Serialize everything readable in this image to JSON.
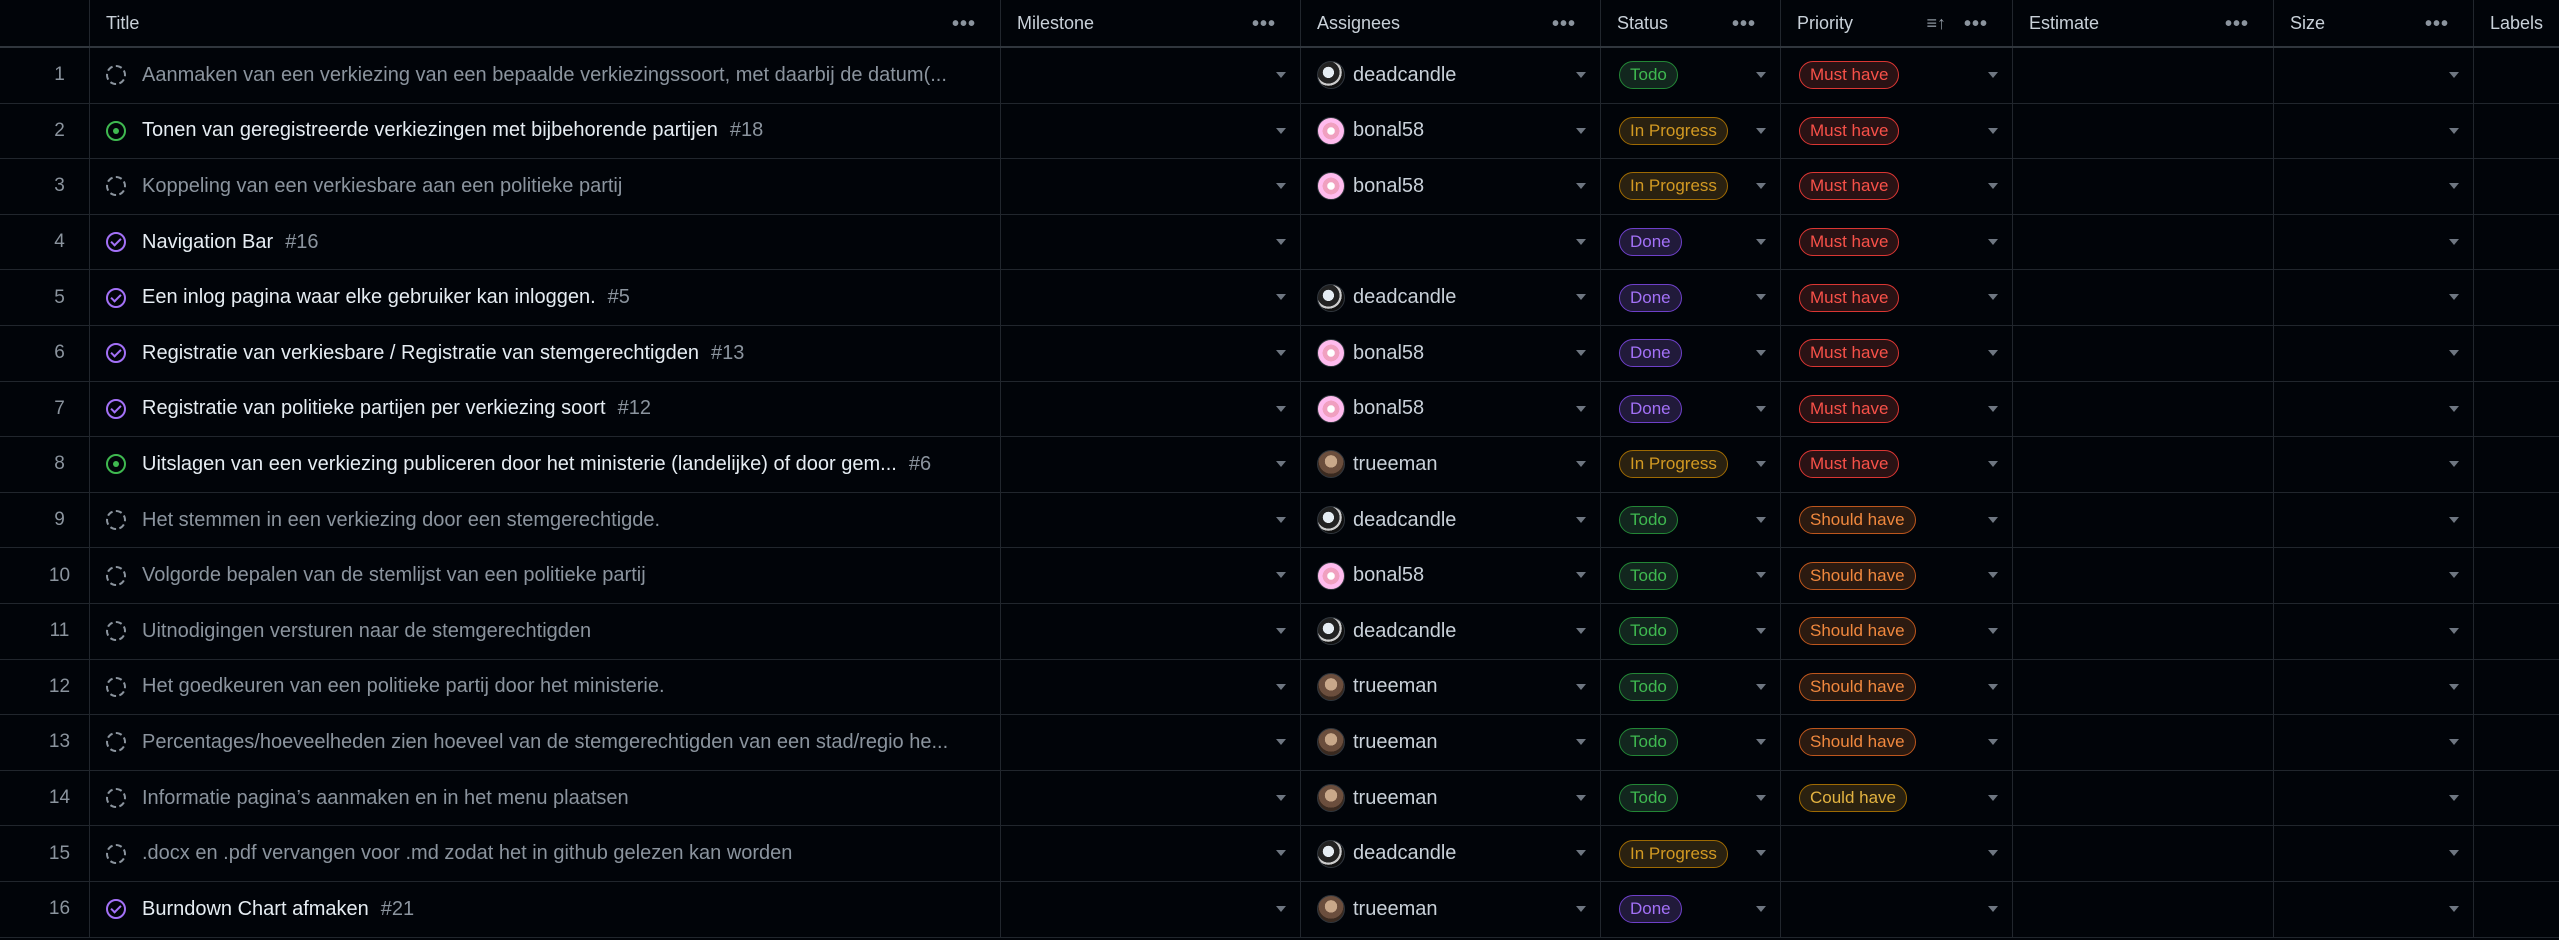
{
  "columns": {
    "title": "Title",
    "milestone": "Milestone",
    "assignees": "Assignees",
    "status": "Status",
    "priority": "Priority",
    "estimate": "Estimate",
    "size": "Size",
    "labels": "Labels",
    "menu_glyph": "•••",
    "sort_glyph": "≡↑"
  },
  "rows": [
    {
      "num": "1",
      "state": "todo",
      "kind": "draft",
      "title": "Aanmaken van een verkiezing van een bepaalde verkiezingssoort, met daarbij de datum(...",
      "issue": "",
      "assignee": "deadcandle",
      "avatar": "deadcandle",
      "status": "Todo",
      "status_kind": "todo",
      "priority": "Must have",
      "priority_kind": "must"
    },
    {
      "num": "2",
      "state": "progress",
      "kind": "issue",
      "title": "Tonen van geregistreerde verkiezingen met bijbehorende partijen",
      "issue": "#18",
      "assignee": "bonal58",
      "avatar": "bonal58",
      "status": "In Progress",
      "status_kind": "progress",
      "priority": "Must have",
      "priority_kind": "must"
    },
    {
      "num": "3",
      "state": "todo",
      "kind": "draft",
      "title": "Koppeling van een verkiesbare aan een politieke partij",
      "issue": "",
      "assignee": "bonal58",
      "avatar": "bonal58",
      "status": "In Progress",
      "status_kind": "progress",
      "priority": "Must have",
      "priority_kind": "must"
    },
    {
      "num": "4",
      "state": "done",
      "kind": "issue",
      "title": "Navigation Bar",
      "issue": "#16",
      "assignee": "",
      "avatar": "",
      "status": "Done",
      "status_kind": "done",
      "priority": "Must have",
      "priority_kind": "must"
    },
    {
      "num": "5",
      "state": "done",
      "kind": "issue",
      "title": "Een inlog pagina waar elke gebruiker kan inloggen.",
      "issue": "#5",
      "assignee": "deadcandle",
      "avatar": "deadcandle",
      "status": "Done",
      "status_kind": "done",
      "priority": "Must have",
      "priority_kind": "must"
    },
    {
      "num": "6",
      "state": "done",
      "kind": "issue",
      "title": "Registratie van verkiesbare / Registratie van stemgerechtigden",
      "issue": "#13",
      "assignee": "bonal58",
      "avatar": "bonal58",
      "status": "Done",
      "status_kind": "done",
      "priority": "Must have",
      "priority_kind": "must"
    },
    {
      "num": "7",
      "state": "done",
      "kind": "issue",
      "title": "Registratie van politieke partijen per verkiezing soort",
      "issue": "#12",
      "assignee": "bonal58",
      "avatar": "bonal58",
      "status": "Done",
      "status_kind": "done",
      "priority": "Must have",
      "priority_kind": "must"
    },
    {
      "num": "8",
      "state": "progress",
      "kind": "issue",
      "title": "Uitslagen van een verkiezing publiceren door het ministerie (landelijke) of door gem...",
      "issue": "#6",
      "assignee": "trueeman",
      "avatar": "trueeman",
      "status": "In Progress",
      "status_kind": "progress",
      "priority": "Must have",
      "priority_kind": "must"
    },
    {
      "num": "9",
      "state": "todo",
      "kind": "draft",
      "title": "Het stemmen in een verkiezing door een stemgerechtigde.",
      "issue": "",
      "assignee": "deadcandle",
      "avatar": "deadcandle",
      "status": "Todo",
      "status_kind": "todo",
      "priority": "Should have",
      "priority_kind": "should"
    },
    {
      "num": "10",
      "state": "todo",
      "kind": "draft",
      "title": "Volgorde bepalen van de stemlijst van een politieke partij",
      "issue": "",
      "assignee": "bonal58",
      "avatar": "bonal58",
      "status": "Todo",
      "status_kind": "todo",
      "priority": "Should have",
      "priority_kind": "should"
    },
    {
      "num": "11",
      "state": "todo",
      "kind": "draft",
      "title": "Uitnodigingen versturen naar de stemgerechtigden",
      "issue": "",
      "assignee": "deadcandle",
      "avatar": "deadcandle",
      "status": "Todo",
      "status_kind": "todo",
      "priority": "Should have",
      "priority_kind": "should"
    },
    {
      "num": "12",
      "state": "todo",
      "kind": "draft",
      "title": "Het goedkeuren van een politieke partij door het ministerie.",
      "issue": "",
      "assignee": "trueeman",
      "avatar": "trueeman",
      "status": "Todo",
      "status_kind": "todo",
      "priority": "Should have",
      "priority_kind": "should"
    },
    {
      "num": "13",
      "state": "todo",
      "kind": "draft",
      "title": "Percentages/hoeveelheden zien hoeveel van de stemgerechtigden van een stad/regio he...",
      "issue": "",
      "assignee": "trueeman",
      "avatar": "trueeman",
      "status": "Todo",
      "status_kind": "todo",
      "priority": "Should have",
      "priority_kind": "should"
    },
    {
      "num": "14",
      "state": "todo",
      "kind": "draft",
      "title": "Informatie pagina’s aanmaken en in het menu plaatsen",
      "issue": "",
      "assignee": "trueeman",
      "avatar": "trueeman",
      "status": "Todo",
      "status_kind": "todo",
      "priority": "Could have",
      "priority_kind": "could"
    },
    {
      "num": "15",
      "state": "todo",
      "kind": "draft",
      "title": ".docx en .pdf vervangen voor .md zodat het in github gelezen kan worden",
      "issue": "",
      "assignee": "deadcandle",
      "avatar": "deadcandle",
      "status": "In Progress",
      "status_kind": "progress",
      "priority": "",
      "priority_kind": ""
    },
    {
      "num": "16",
      "state": "done",
      "kind": "issue",
      "title": "Burndown Chart afmaken",
      "issue": "#21",
      "assignee": "trueeman",
      "avatar": "trueeman",
      "status": "Done",
      "status_kind": "done",
      "priority": "",
      "priority_kind": ""
    }
  ]
}
